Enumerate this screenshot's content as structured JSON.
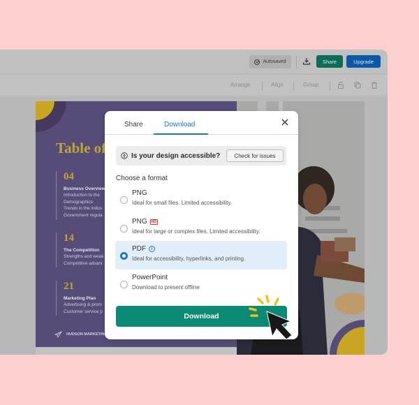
{
  "topbar": {
    "autosaved_label": "Autosaved",
    "download_icon": "download-icon",
    "share_label": "Share",
    "upgrade_label": "Upgrade"
  },
  "toolbar": {
    "arrange_label": "Arrange",
    "align_label": "Align",
    "group_label": "Group",
    "icons": [
      "lock-icon",
      "duplicate-icon",
      "trash-icon"
    ]
  },
  "slide": {
    "title": "Table of",
    "sections": [
      {
        "number": "04",
        "heading": "Business Overview",
        "lines": [
          "Introduction to the",
          "Demographics",
          "Trends in the indus",
          "Government regula"
        ]
      },
      {
        "number": "14",
        "heading": "The Competition",
        "lines": [
          "Strengths and weak",
          "Competitive advant"
        ]
      },
      {
        "number": "21",
        "heading": "Marketing Plan",
        "lines": [
          "Advertising & prom",
          "Customer service p"
        ]
      }
    ],
    "brand": "HUDSON MARKETING",
    "colors": {
      "purple": "#564c77",
      "gold": "#bfa436"
    }
  },
  "modal": {
    "tabs": [
      {
        "label": "Share",
        "active": false
      },
      {
        "label": "Download",
        "active": true
      }
    ],
    "accessibility_prompt": "Is your design accessible?",
    "check_button_label": "Check for issues",
    "choose_format_label": "Choose a format",
    "formats": [
      {
        "name": "PNG",
        "badge": "",
        "info": false,
        "description": "Ideal for small files. Limited accessibility.",
        "selected": false
      },
      {
        "name": "PNG",
        "badge": "HD",
        "info": false,
        "description": "Ideal for large or complex files. Limited accessibility.",
        "selected": false
      },
      {
        "name": "PDF",
        "badge": "",
        "info": true,
        "description": "Ideal for accessibility, hyperlinks, and printing.",
        "selected": true
      },
      {
        "name": "PowerPoint",
        "badge": "",
        "info": false,
        "description": "Download to present offline",
        "selected": false
      }
    ],
    "download_button_label": "Download",
    "colors": {
      "accent": "#1b79c9",
      "primary_button": "#0b8a74"
    }
  }
}
